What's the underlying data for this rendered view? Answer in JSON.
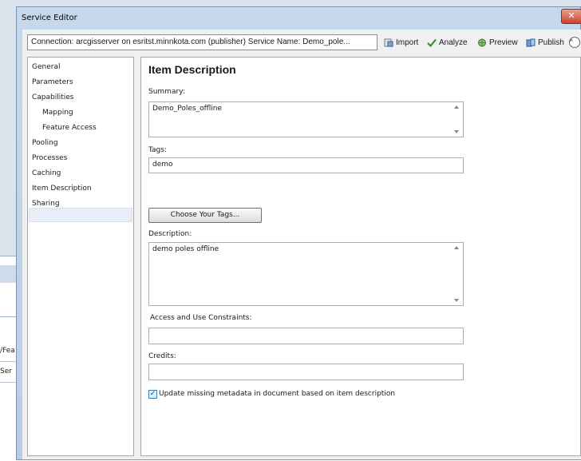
{
  "background": {
    "fragment1": "/Fea",
    "fragment2": "Ser"
  },
  "window": {
    "title": "Service Editor",
    "close_label": "✕"
  },
  "toolbar": {
    "connection": "Connection: arcgisserver on esritst.minnkota.com (publisher)   Service Name: Demo_pole...",
    "import_label": "Import",
    "analyze_label": "Analyze",
    "preview_label": "Preview",
    "publish_label": "Publish",
    "collapse_label": "^"
  },
  "nav": {
    "items": [
      {
        "label": "General"
      },
      {
        "label": "Parameters"
      },
      {
        "label": "Capabilities"
      },
      {
        "label": "Mapping"
      },
      {
        "label": "Feature Access"
      },
      {
        "label": "Pooling"
      },
      {
        "label": "Processes"
      },
      {
        "label": "Caching"
      },
      {
        "label": "Item Description"
      },
      {
        "label": "Sharing"
      }
    ]
  },
  "main": {
    "heading": "Item Description",
    "summary_label": "Summary:",
    "summary_value": "Demo_Poles_offline",
    "tags_label": "Tags:",
    "tags_value": "demo",
    "choose_tags_label": "Choose Your Tags...",
    "description_label": "Description:",
    "description_value": "demo poles offline",
    "constraints_label": "Access and Use Constraints:",
    "constraints_value": "",
    "credits_label": "Credits:",
    "credits_value": "",
    "update_metadata_label": "Update missing metadata in document based on item description",
    "update_metadata_checked": true
  },
  "colors": {
    "accent_arrow": "#e0231a",
    "analyze_check": "#2e8b24",
    "selected_nav": "#e7eef7"
  }
}
